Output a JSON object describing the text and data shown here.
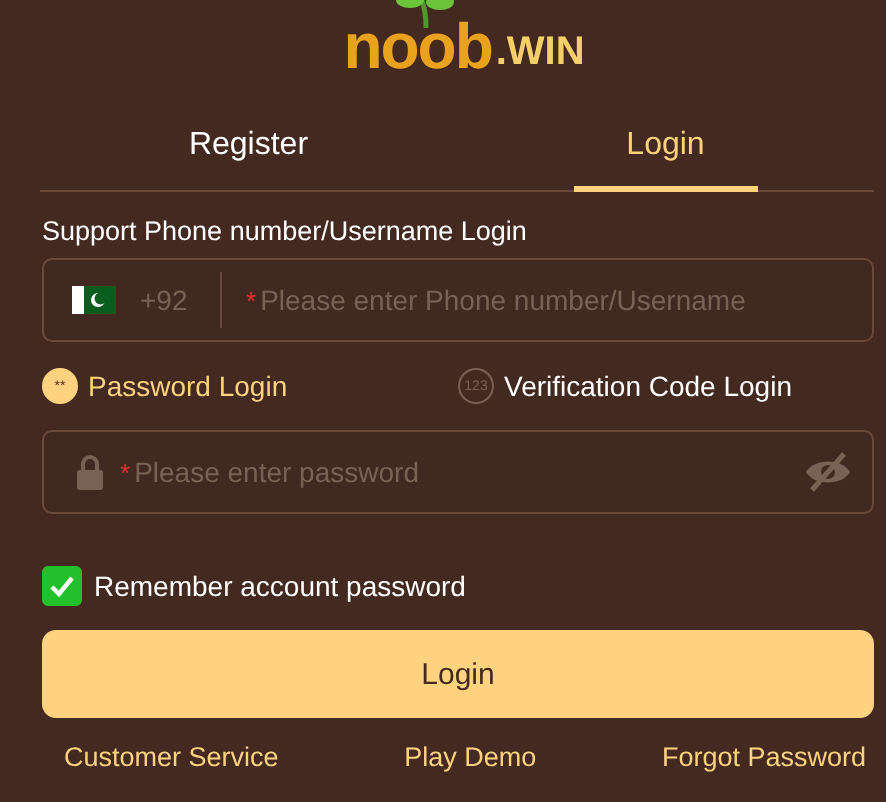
{
  "logo": {
    "name": "noob",
    "suffix": ".WIN"
  },
  "tabs": [
    {
      "label": "Register",
      "selected": false
    },
    {
      "label": "Login",
      "selected": true
    }
  ],
  "phone_label": "Support Phone number/Username Login",
  "phone_field": {
    "country_code": "+92",
    "required_mark": "*",
    "placeholder": "Please enter Phone number/Username"
  },
  "login_modes": [
    {
      "kind": "password",
      "icon_text": "**",
      "label": "Password Login",
      "selected": true
    },
    {
      "kind": "code",
      "icon_text": "123",
      "label": "Verification Code Login",
      "selected": false
    }
  ],
  "password_field": {
    "required_mark": "*",
    "placeholder": "Please enter password"
  },
  "remember": {
    "label": "Remember account password",
    "checked": true
  },
  "login_button": "Login",
  "links": [
    "Customer Service",
    "Play Demo",
    "Forgot Password"
  ]
}
